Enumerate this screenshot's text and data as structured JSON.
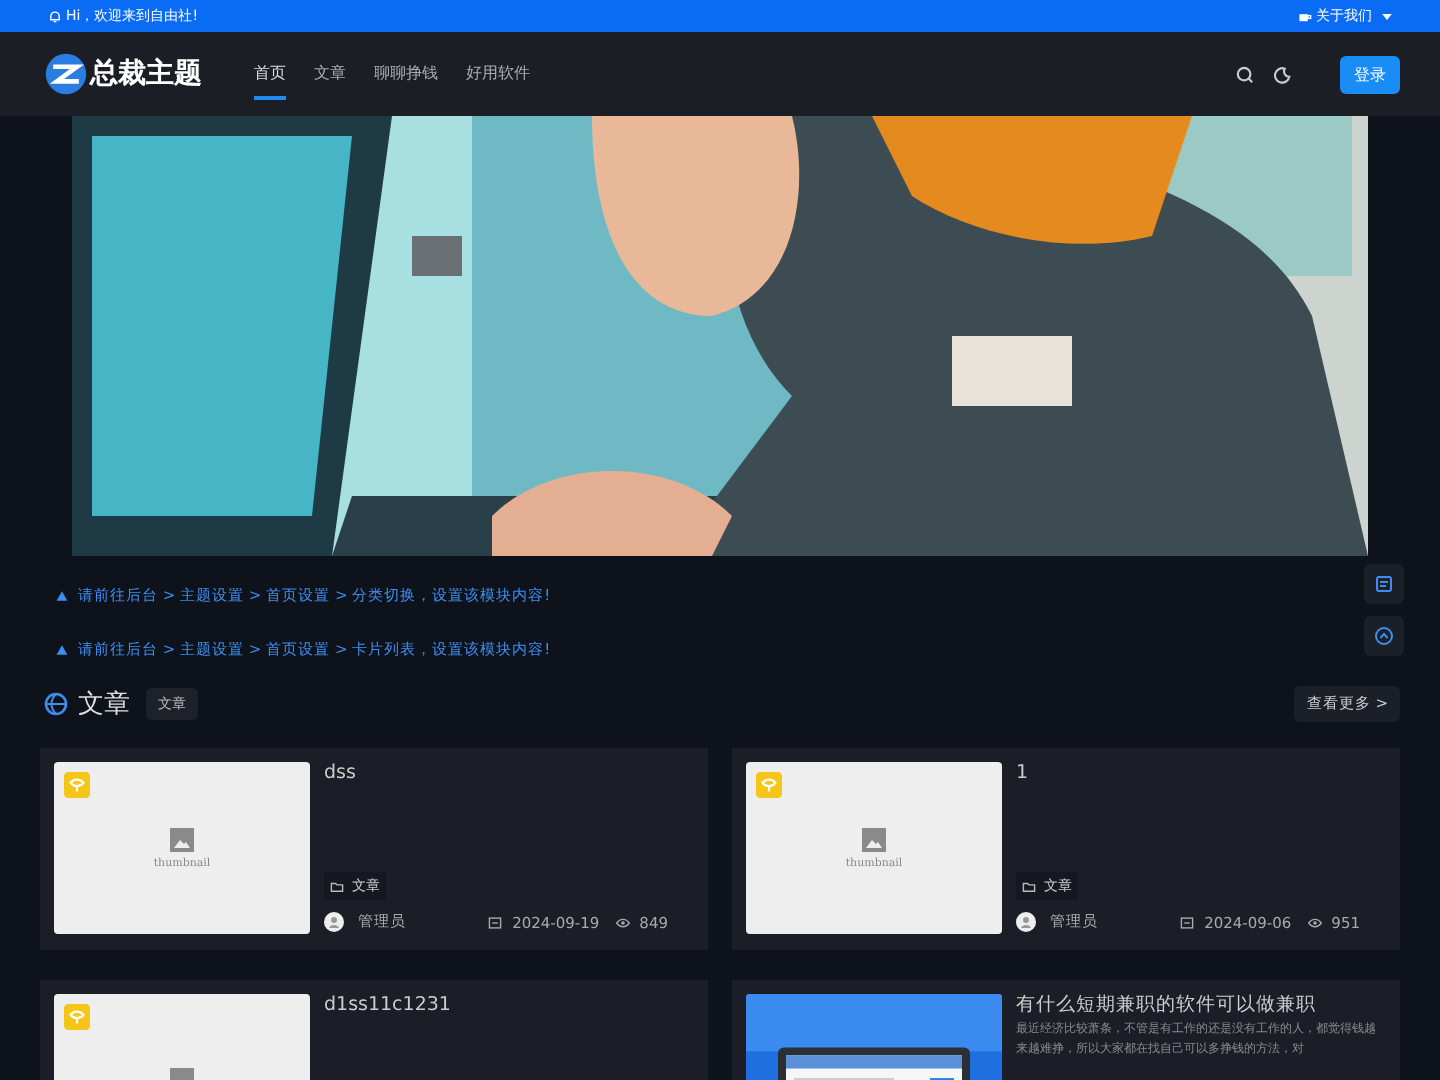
{
  "topbar": {
    "greeting": "Hi，欢迎来到自由社!",
    "about": "关于我们"
  },
  "header": {
    "logo_text": "总裁主题",
    "nav": [
      {
        "label": "首页",
        "selected": true
      },
      {
        "label": "文章",
        "selected": false
      },
      {
        "label": "聊聊挣钱",
        "selected": false
      },
      {
        "label": "好用软件",
        "selected": false
      }
    ],
    "login": "登录"
  },
  "notices": [
    "请前往后台 > 主题设置 > 首页设置 > 分类切换，设置该模块内容!",
    "请前往后台 > 主题设置 > 首页设置 > 卡片列表，设置该模块内容!"
  ],
  "section": {
    "title": "文章",
    "tag": "文章",
    "more": "查看更多 >"
  },
  "posts": [
    {
      "title": "dss",
      "kind": "placeholder",
      "thumb_text": "thumbnail",
      "category": "文章",
      "author": "管理员",
      "date": "2024-09-19",
      "views": "849"
    },
    {
      "title": "1",
      "kind": "placeholder",
      "thumb_text": "thumbnail",
      "category": "文章",
      "author": "管理员",
      "date": "2024-09-06",
      "views": "951"
    },
    {
      "title": "d1ss11c1231",
      "kind": "placeholder"
    },
    {
      "title": "有什么短期兼职的软件可以做兼职",
      "kind": "picture",
      "excerpt": "最近经济比较萧条，不管是有工作的还是没有工作的人，都觉得钱越来越难挣，所以大家都在找自己可以多挣钱的方法，对"
    }
  ]
}
